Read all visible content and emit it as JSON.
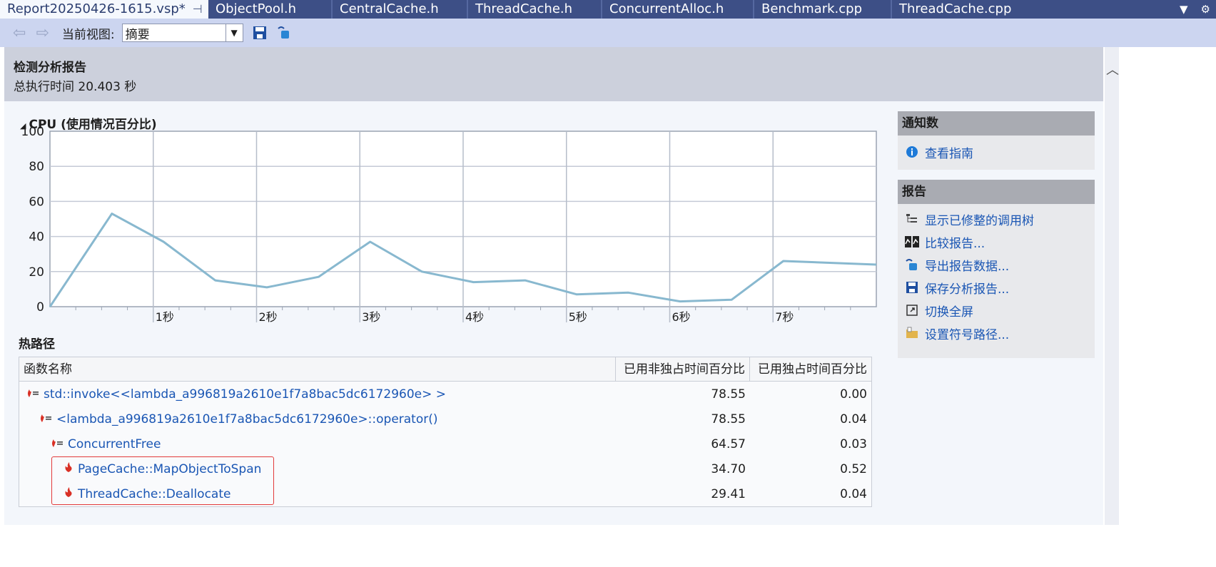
{
  "tabs": [
    {
      "label": "Report20250426-1615.vsp*",
      "active": true
    },
    {
      "label": "ObjectPool.h"
    },
    {
      "label": "CentralCache.h"
    },
    {
      "label": "ThreadCache.h"
    },
    {
      "label": "ConcurrentAlloc.h"
    },
    {
      "label": "Benchmark.cpp"
    },
    {
      "label": "ThreadCache.cpp"
    }
  ],
  "toolbar": {
    "view_label": "当前视图:",
    "view_value": "摘要"
  },
  "header": {
    "title": "检测分析报告",
    "subtitle": "总执行时间 20.403 秒"
  },
  "cpu": {
    "title": "CPU (使用情况百分比)"
  },
  "chart_data": {
    "type": "line",
    "title": "CPU (使用情况百分比)",
    "ylim": [
      0,
      100
    ],
    "yticks": [
      0,
      20,
      40,
      60,
      80,
      100
    ],
    "xlim": [
      0,
      8
    ],
    "xtick_labels": [
      "1秒",
      "2秒",
      "3秒",
      "4秒",
      "5秒",
      "6秒",
      "7秒"
    ],
    "x": [
      0,
      0.6,
      1.1,
      1.6,
      2.1,
      2.6,
      3.1,
      3.6,
      4.1,
      4.6,
      5.1,
      5.6,
      6.1,
      6.6,
      7.1,
      8.0
    ],
    "values": [
      -3,
      53,
      37,
      15,
      11,
      17,
      37,
      20,
      14,
      15,
      7,
      8,
      3,
      4,
      26,
      24
    ],
    "color": "#88b8cf",
    "grid": true
  },
  "hot_path": {
    "title": "热路径",
    "columns": [
      "函数名称",
      "已用非独占时间百分比",
      "已用独占时间百分比"
    ],
    "rows": [
      {
        "name": "std::invoke<<lambda_a996819a2610e1f7a8bac5dc6172960e> >",
        "inclusive": "78.55",
        "exclusive": "0.00"
      },
      {
        "name": "<lambda_a996819a2610e1f7a8bac5dc6172960e>::operator()",
        "inclusive": "78.55",
        "exclusive": "0.04"
      },
      {
        "name": "ConcurrentFree",
        "inclusive": "64.57",
        "exclusive": "0.03"
      },
      {
        "name": "PageCache::MapObjectToSpan",
        "inclusive": "34.70",
        "exclusive": "0.52"
      },
      {
        "name": "ThreadCache::Deallocate",
        "inclusive": "29.41",
        "exclusive": "0.04"
      }
    ]
  },
  "notifications": {
    "title": "通知数",
    "items": [
      {
        "label": "查看指南",
        "icon": "info-icon"
      }
    ]
  },
  "report": {
    "title": "报告",
    "items": [
      {
        "label": "显示已修整的调用树",
        "icon": "call-tree-icon"
      },
      {
        "label": "比较报告...",
        "icon": "compare-icon"
      },
      {
        "label": "导出报告数据...",
        "icon": "export-icon"
      },
      {
        "label": "保存分析报告...",
        "icon": "save-icon"
      },
      {
        "label": "切换全屏",
        "icon": "fullscreen-icon"
      },
      {
        "label": "设置符号路径...",
        "icon": "folder-icon"
      }
    ]
  }
}
